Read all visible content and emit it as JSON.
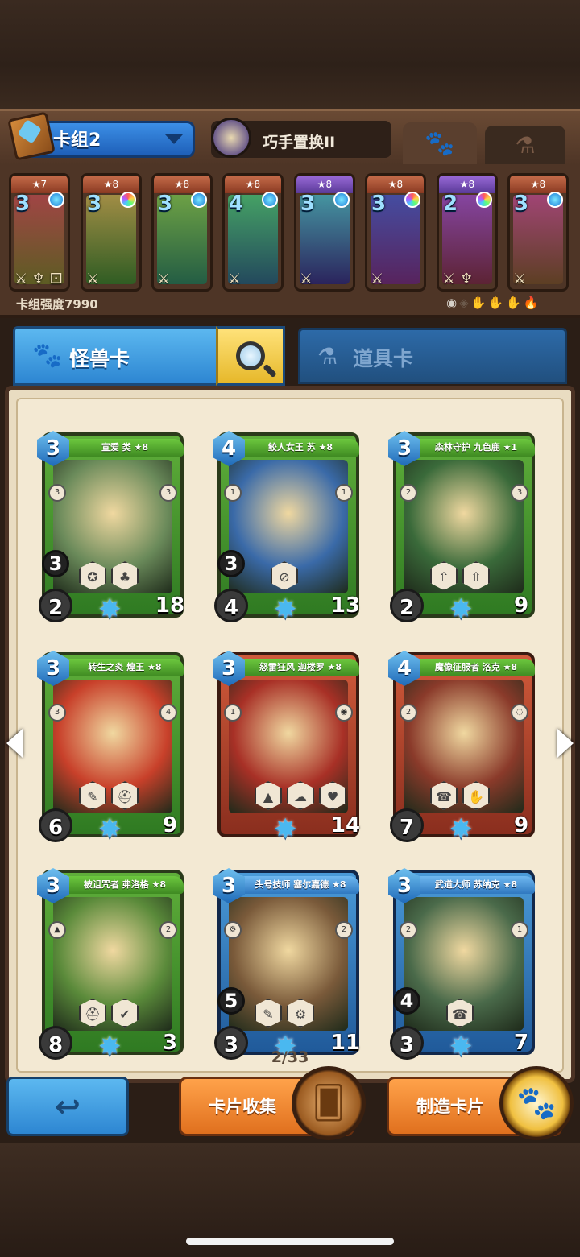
{
  "header": {
    "deck_name": "卡组2",
    "skill_name": "巧手置换II",
    "tabs": [
      {
        "name": "paw-tab",
        "icon": "paw-icon",
        "active": true
      },
      {
        "name": "potion-tab",
        "icon": "potion-icon",
        "active": false
      }
    ]
  },
  "deck": {
    "power_label": "卡组强度7990",
    "cards": [
      {
        "cost": "3",
        "stars": "★7",
        "frame": "red",
        "gem": "blue",
        "icons": "⚔ ♆ ⚀"
      },
      {
        "cost": "3",
        "stars": "★8",
        "frame": "red",
        "gem": "rainbow",
        "icons": "⚔"
      },
      {
        "cost": "3",
        "stars": "★8",
        "frame": "red",
        "gem": "blue",
        "icons": "⚔"
      },
      {
        "cost": "4",
        "stars": "★8",
        "frame": "red",
        "gem": "blue",
        "icons": "⚔"
      },
      {
        "cost": "3",
        "stars": "★8",
        "frame": "purple",
        "gem": "blue",
        "icons": "⚔"
      },
      {
        "cost": "3",
        "stars": "★8",
        "frame": "red",
        "gem": "rainbow",
        "icons": "⚔"
      },
      {
        "cost": "2",
        "stars": "★8",
        "frame": "purple",
        "gem": "rainbow",
        "icons": "⚔ ♆"
      },
      {
        "cost": "3",
        "stars": "★8",
        "frame": "red",
        "gem": "blue",
        "icons": "⚔"
      }
    ],
    "elements": [
      "◉",
      "◈",
      "✋",
      "✋",
      "✋",
      "🔥"
    ]
  },
  "tabs": {
    "monster": "怪兽卡",
    "items": "道具卡"
  },
  "cards": [
    {
      "name": "宣爱 类 ★8",
      "cost": "3",
      "atk": "2",
      "hp": "18",
      "extra": "3",
      "trait_l": "3",
      "trait_r": "3",
      "skills": [
        "✪",
        "♣"
      ],
      "frame": "green",
      "art": "#6a8a5a"
    },
    {
      "name": "鲛人女王 苏 ★8",
      "cost": "4",
      "atk": "4",
      "hp": "13",
      "extra": "3",
      "trait_l": "1",
      "trait_r": "1",
      "skills": [
        "⊘"
      ],
      "frame": "green",
      "art": "#3a6aa8"
    },
    {
      "name": "森林守护 九色鹿 ★1",
      "cost": "3",
      "atk": "2",
      "hp": "9",
      "extra": "",
      "trait_l": "2",
      "trait_r": "3",
      "skills": [
        "⇧",
        "⇧"
      ],
      "frame": "green",
      "art": "#3a6a3a"
    },
    {
      "name": "转生之炎 煌王 ★8",
      "cost": "3",
      "atk": "6",
      "hp": "9",
      "extra": "",
      "trait_l": "3",
      "trait_r": "4",
      "skills": [
        "✎",
        "⛑"
      ],
      "frame": "green",
      "art": "#c8402a"
    },
    {
      "name": "怒雷狂风 迦楼罗 ★8",
      "cost": "3",
      "atk": "",
      "hp": "14",
      "extra": "",
      "trait_l": "1",
      "trait_r": "◉",
      "skills": [
        "▲",
        "☁",
        "♥"
      ],
      "frame": "red",
      "art": "#a83026"
    },
    {
      "name": "魔像征服者 洛克 ★8",
      "cost": "4",
      "atk": "7",
      "hp": "9",
      "extra": "",
      "trait_l": "2",
      "trait_r": "◌",
      "skills": [
        "☎",
        "✋"
      ],
      "frame": "red",
      "art": "#8a3a2a"
    },
    {
      "name": "被诅咒者 弗洛格 ★8",
      "cost": "3",
      "atk": "8",
      "hp": "3",
      "extra": "",
      "trait_l": "▲",
      "trait_r": "2",
      "skills": [
        "⛑",
        "✔"
      ],
      "frame": "green",
      "art": "#5a8a3a"
    },
    {
      "name": "头号技师 塞尔嘉德 ★8",
      "cost": "3",
      "atk": "3",
      "hp": "11",
      "extra": "5",
      "trait_l": "⚙",
      "trait_r": "2",
      "skills": [
        "✎",
        "⚙"
      ],
      "frame": "blue",
      "art": "#7a5a3a"
    },
    {
      "name": "武道大师 苏纳克 ★8",
      "cost": "3",
      "atk": "3",
      "hp": "7",
      "extra": "4",
      "trait_l": "2",
      "trait_r": "1",
      "skills": [
        "☎"
      ],
      "frame": "blue",
      "art": "#4a6a4a"
    }
  ],
  "page": "2/33",
  "buttons": {
    "back": "↩",
    "collect": "卡片收集",
    "craft": "制造卡片"
  }
}
